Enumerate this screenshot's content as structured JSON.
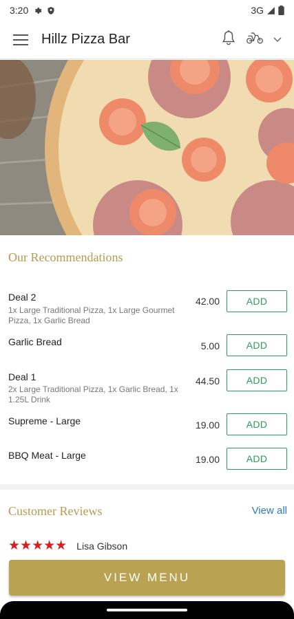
{
  "status_bar": {
    "time": "3:20",
    "network": "3G",
    "icons": [
      "gear-icon",
      "shield-icon",
      "signal-icon",
      "battery-icon"
    ]
  },
  "app_bar": {
    "title": "Hillz Pizza Bar",
    "icons": [
      "hamburger-menu-icon",
      "bell-icon",
      "scooter-icon",
      "chevron-down-icon"
    ]
  },
  "hero": {
    "image": "pizza-photo"
  },
  "recommendations": {
    "title": "Our Recommendations",
    "items": [
      {
        "name": "Deal 2",
        "description": "1x Large Traditional Pizza, 1x Large Gourmet Pizza, 1x Garlic Bread",
        "price": "42.00",
        "add_label": "ADD"
      },
      {
        "name": "Garlic Bread",
        "description": "",
        "price": "5.00",
        "add_label": "ADD"
      },
      {
        "name": "Deal 1",
        "description": "2x Large Traditional Pizza, 1x Garlic Bread, 1x 1.25L Drink",
        "price": "44.50",
        "add_label": "ADD"
      },
      {
        "name": "Supreme - Large",
        "description": "",
        "price": "19.00",
        "add_label": "ADD"
      },
      {
        "name": "BBQ Meat - Large",
        "description": "",
        "price": "19.00",
        "add_label": "ADD"
      }
    ]
  },
  "reviews": {
    "title": "Customer Reviews",
    "view_all": "View all",
    "first_review": {
      "rating": 5,
      "stars": "★★★★★",
      "reviewer": "Lisa Gibson"
    }
  },
  "footer": {
    "view_menu_label": "VIEW MENU"
  },
  "colors": {
    "accent_gold": "#b9a352",
    "section_title": "#b39a55",
    "add_green": "#2e9b56",
    "link_blue": "#2b7bb9",
    "star_red": "#d42020"
  }
}
